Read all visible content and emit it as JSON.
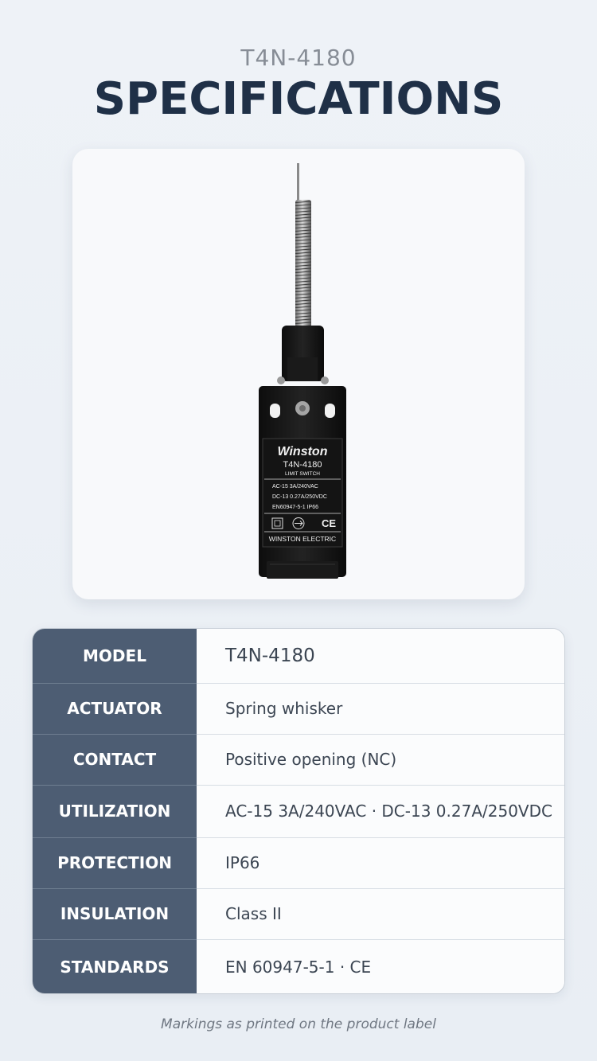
{
  "header": {
    "model_code": "T4N-4180",
    "title": "SPECIFICATIONS"
  },
  "product": {
    "brand": "Winston",
    "model": "T4N-4180",
    "type": "LIMIT SWITCH",
    "rating_ac": "AC-15 3A/240VAC",
    "rating_dc": "DC-13 0.27A/250VDC",
    "standard": "EN60947-5-1 IP66",
    "ce_mark": "CE",
    "manufacturer": "WINSTON ELECTRIC"
  },
  "specs": [
    {
      "key": "MODEL",
      "value": "T4N-4180"
    },
    {
      "key": "ACTUATOR",
      "value": "Spring whisker"
    },
    {
      "key": "CONTACT",
      "value": "Positive opening (NC)"
    },
    {
      "key": "UTILIZATION",
      "value": "AC-15 3A/240VAC · DC-13 0.27A/250VDC"
    },
    {
      "key": "PROTECTION",
      "value": "IP66"
    },
    {
      "key": "INSULATION",
      "value": "Class II"
    },
    {
      "key": "STANDARDS",
      "value": "EN 60947-5-1 · CE"
    }
  ],
  "footnote": "Markings as printed on the product label",
  "colors": {
    "title": "#1f3047",
    "key_cell": "#4d5d73",
    "background": "#eef2f7"
  }
}
